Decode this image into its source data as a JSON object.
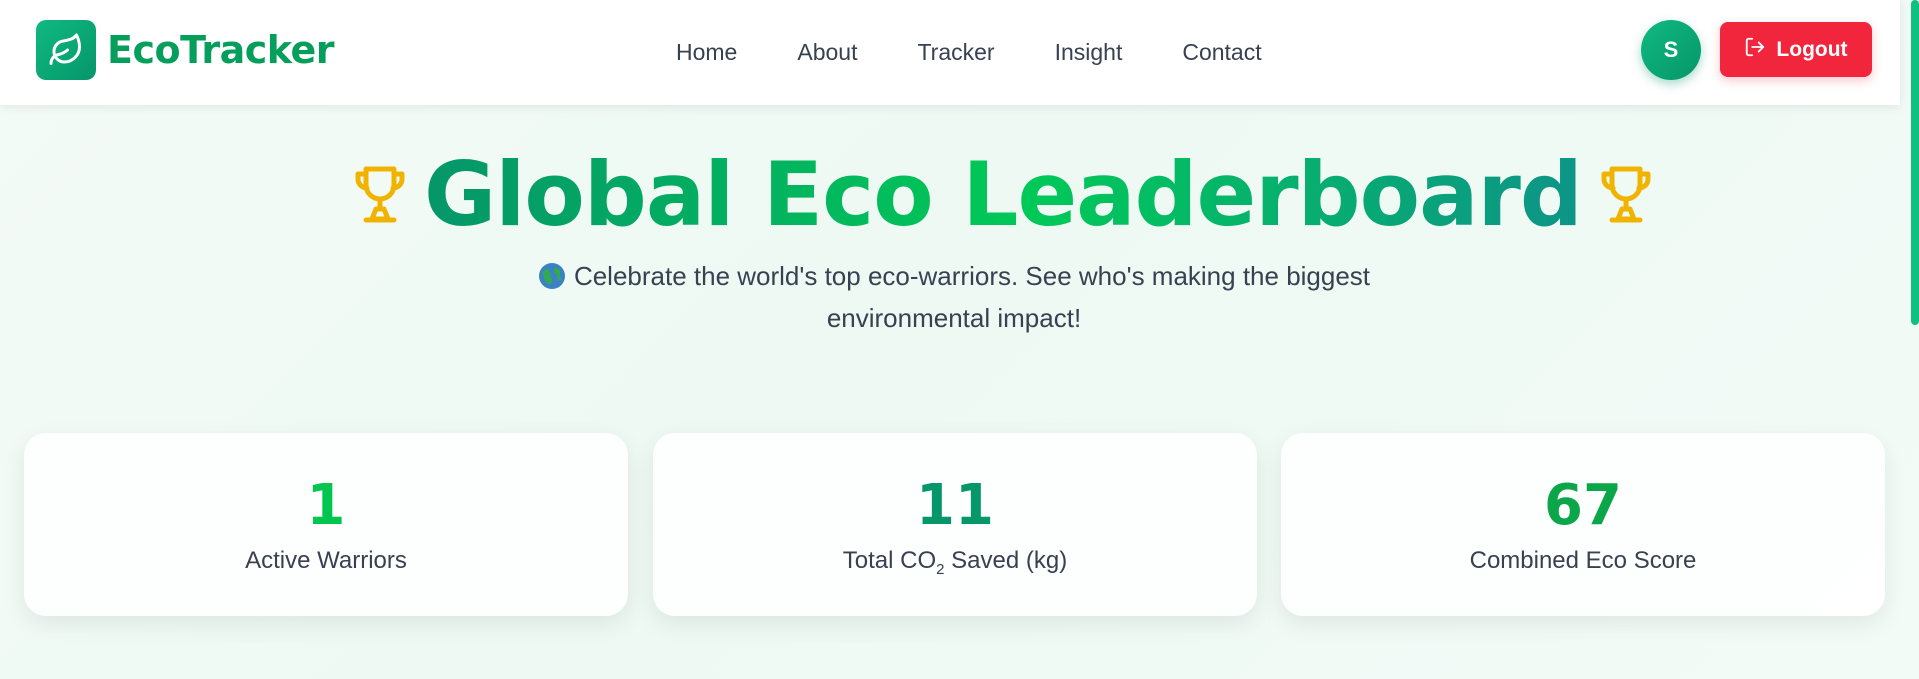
{
  "brand": {
    "name": "EcoTracker",
    "icon": "leaf-icon",
    "color": "#059e5a"
  },
  "nav": {
    "links": [
      {
        "label": "Home"
      },
      {
        "label": "About"
      },
      {
        "label": "Tracker"
      },
      {
        "label": "Insight"
      },
      {
        "label": "Contact"
      }
    ]
  },
  "user": {
    "avatar_initial": "S"
  },
  "logout": {
    "label": "Logout",
    "icon": "logout-icon",
    "color": "#f1263c"
  },
  "hero": {
    "title": "Global Eco Leaderboard",
    "trophy_icon": "trophy-icon",
    "subtitle_line1": "Celebrate the world's top eco-warriors. See who's making the biggest",
    "subtitle_line2": "environmental impact!",
    "subtitle_icon": "globe-icon"
  },
  "stats": [
    {
      "value": "1",
      "label": "Active Warriors",
      "color": "#00c64f"
    },
    {
      "value": "11",
      "label_prefix": "Total CO",
      "label_sub": "2",
      "label_suffix": " Saved (kg)",
      "color": "#059669"
    },
    {
      "value": "67",
      "label": "Combined Eco Score",
      "color": "#0ca64a"
    }
  ],
  "colors": {
    "accent": "#10b981",
    "trophy": "#f0b400"
  }
}
